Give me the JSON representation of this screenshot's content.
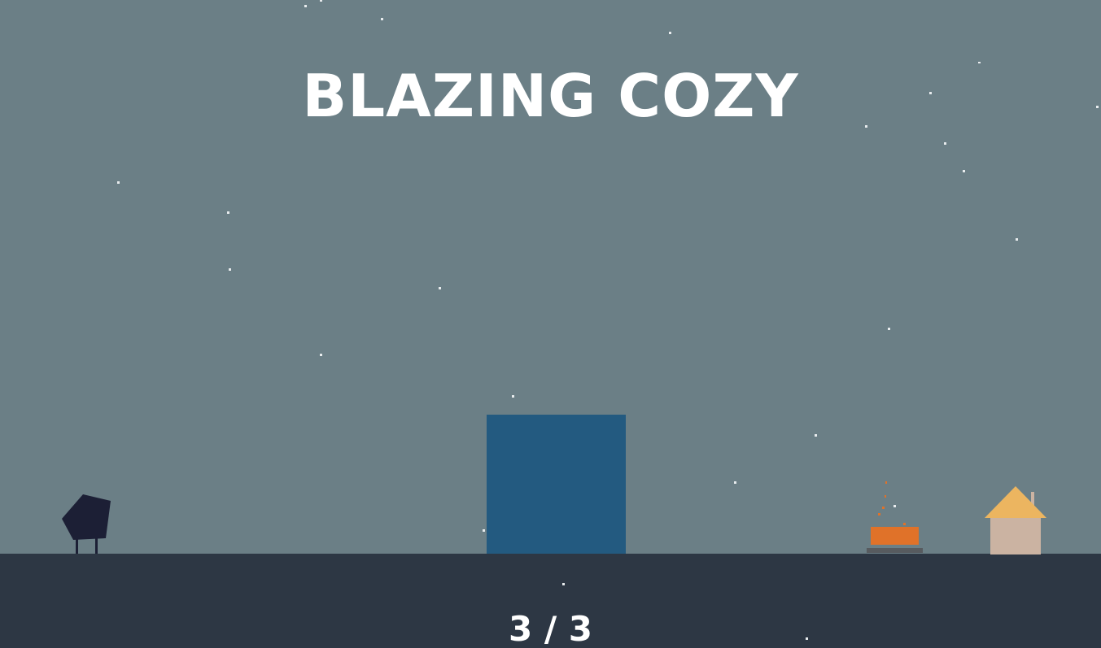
{
  "game": {
    "title": "BLAZING COZY",
    "level_indicator": "3 / 3"
  },
  "colors": {
    "sky": "#6b7f86",
    "ground": "#2d3744",
    "block": "#235a80",
    "player": "#1c1f35",
    "fire": "#e07229",
    "fire_base": "#575b5f",
    "house_roof": "#ecb560",
    "house_wall": "#cbb3a2",
    "chimney": "#cbb3a2",
    "star": "#e8ecee",
    "text": "#ffffff"
  },
  "icons": {
    "player": "pentagon-character-icon",
    "block": "pushable-square-block",
    "campfire": "campfire-icon",
    "house": "house-icon"
  }
}
